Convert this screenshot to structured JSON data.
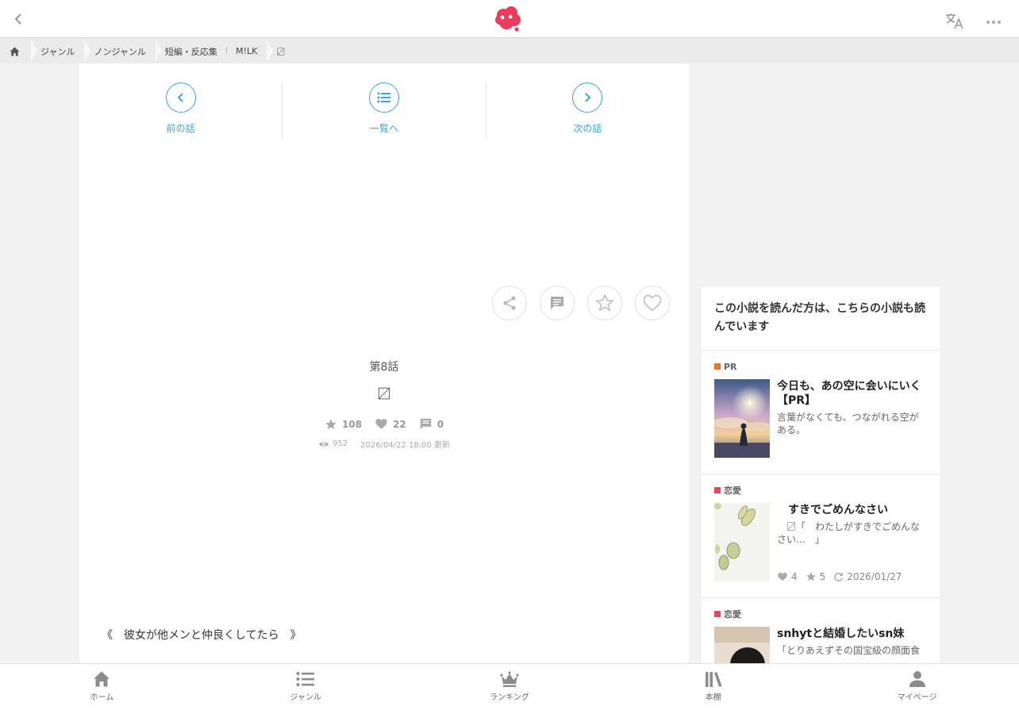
{
  "header": {
    "brand_color": "#f03a5b",
    "icons": [
      "back-icon",
      "logo-icon",
      "translate-icon",
      "more-icon"
    ]
  },
  "breadcrumb": {
    "items": [
      "ジャンル",
      "ノンジャンル",
      "短編・反応集",
      "M!LK",
      "〼"
    ],
    "separator": "⁝"
  },
  "nav": {
    "prev_label": "前の話",
    "list_label": "一覧へ",
    "next_label": "次の話",
    "accent": "#3aa6d8"
  },
  "episode": {
    "number": "第8話",
    "title": "〼",
    "stars": "108",
    "likes": "22",
    "comments": "0",
    "views": "952",
    "updated": "2026/04/22 18:00 更新"
  },
  "body": {
    "first_line": "《　彼女が他メンと仲良くしてたら　》"
  },
  "sidebar": {
    "heading": "この小説を読んだ方は、こちらの小説も読んでいます",
    "cards": [
      {
        "tag": "PR",
        "tag_color": "#f07030",
        "title": "今日も、あの空に会いにいく【PR】",
        "desc": "言葉がなくても、つながれる空がある。"
      },
      {
        "tag": "恋愛",
        "tag_color": "#e8455f",
        "title": "　すきでごめんなさい",
        "desc": "　〼「　わたしがすきでごめんなさい…　」",
        "likes": "4",
        "stars": "5",
        "date": "2026/01/27"
      },
      {
        "tag": "恋愛",
        "tag_color": "#e8455f",
        "title": "snhytと結婚したいsn妹",
        "desc": "「とりあえずその国宝級の顔面食"
      }
    ]
  },
  "tabbar": {
    "home": "ホーム",
    "genre": "ジャンル",
    "ranking": "ランキング",
    "shelf": "本棚",
    "mypage": "マイページ"
  }
}
